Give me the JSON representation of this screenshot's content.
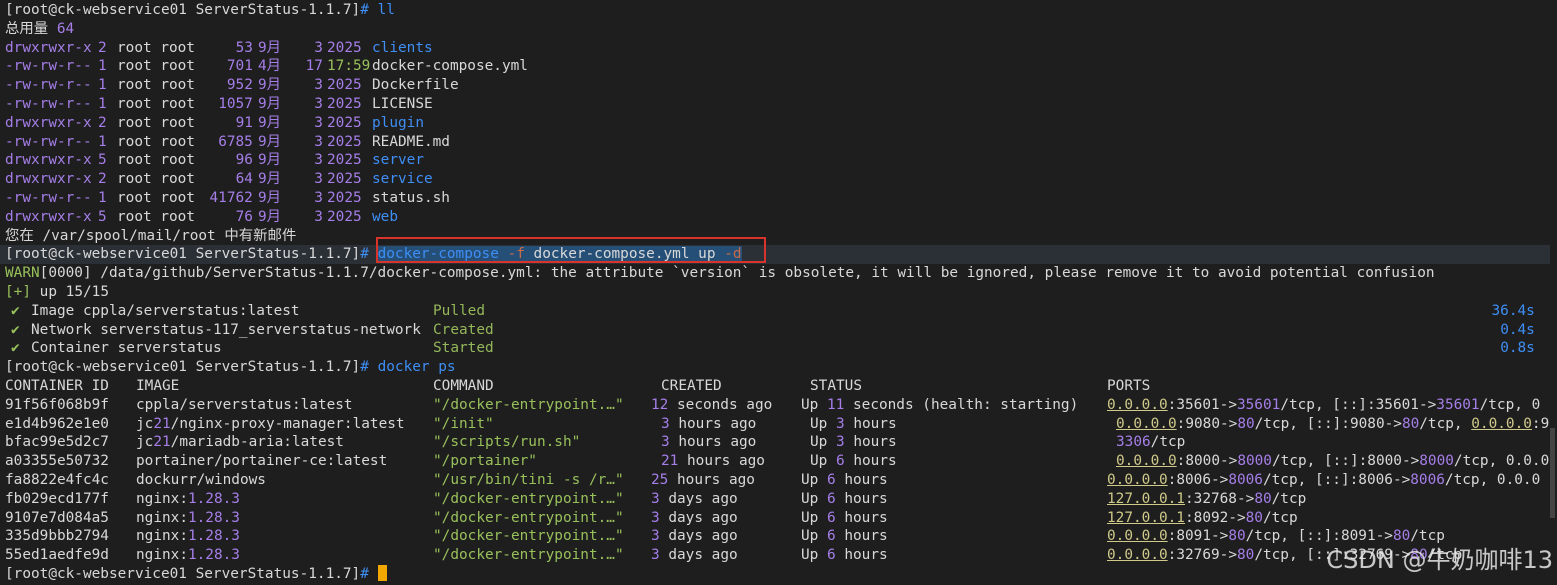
{
  "prompt_user": "[root@ck-webservice01 ServerStatus-1.1.7]",
  "prompt_hash": "#",
  "cmd1": "ll",
  "total": "总用量 64",
  "files": [
    {
      "perm": "drwxrwxr-x",
      "links": "2",
      "owner": "root root",
      "size": "53",
      "month": "9月",
      "day": "3",
      "time": "2025",
      "name": "clients",
      "type": "dir"
    },
    {
      "perm": "-rw-rw-r--",
      "links": "1",
      "owner": "root root",
      "size": "701",
      "month": "4月",
      "day": "17",
      "time": "17:59",
      "name": "docker-compose.yml",
      "type": "file"
    },
    {
      "perm": "-rw-rw-r--",
      "links": "1",
      "owner": "root root",
      "size": "952",
      "month": "9月",
      "day": "3",
      "time": "2025",
      "name": "Dockerfile",
      "type": "file"
    },
    {
      "perm": "-rw-rw-r--",
      "links": "1",
      "owner": "root root",
      "size": "1057",
      "month": "9月",
      "day": "3",
      "time": "2025",
      "name": "LICENSE",
      "type": "file"
    },
    {
      "perm": "drwxrwxr-x",
      "links": "2",
      "owner": "root root",
      "size": "91",
      "month": "9月",
      "day": "3",
      "time": "2025",
      "name": "plugin",
      "type": "dir"
    },
    {
      "perm": "-rw-rw-r--",
      "links": "1",
      "owner": "root root",
      "size": "6785",
      "month": "9月",
      "day": "3",
      "time": "2025",
      "name": "README.md",
      "type": "file"
    },
    {
      "perm": "drwxrwxr-x",
      "links": "5",
      "owner": "root root",
      "size": "96",
      "month": "9月",
      "day": "3",
      "time": "2025",
      "name": "server",
      "type": "dir"
    },
    {
      "perm": "drwxrwxr-x",
      "links": "2",
      "owner": "root root",
      "size": "64",
      "month": "9月",
      "day": "3",
      "time": "2025",
      "name": "service",
      "type": "dir"
    },
    {
      "perm": "-rw-rw-r--",
      "links": "1",
      "owner": "root root",
      "size": "41762",
      "month": "9月",
      "day": "3",
      "time": "2025",
      "name": "status.sh",
      "type": "file"
    },
    {
      "perm": "drwxrwxr-x",
      "links": "5",
      "owner": "root root",
      "size": "76",
      "month": "9月",
      "day": "3",
      "time": "2025",
      "name": "web",
      "type": "dir"
    }
  ],
  "mail": "您在 /var/spool/mail/root 中有新邮件",
  "cmd2": "docker-compose -f docker-compose.yml up -d",
  "warn": "WARN[0000] /data/github/ServerStatus-1.1.7/docker-compose.yml: the attribute `version` is obsolete, it will be ignored, please remove it to avoid potential confusion",
  "up_prefix": "[+]",
  "up_text": "up 15/15",
  "compose_steps": [
    {
      "check": "✔",
      "label": "Image cppla/serverstatus:latest",
      "status": "Pulled",
      "time": "36.4s"
    },
    {
      "check": "✔",
      "label": "Network serverstatus-117_serverstatus-network",
      "status": "Created",
      "time": "0.4s"
    },
    {
      "check": "✔",
      "label": "Container serverstatus",
      "status": "Started",
      "time": "0.8s"
    }
  ],
  "cmd3": "docker ps",
  "ps_headers": [
    "CONTAINER ID",
    "IMAGE",
    "COMMAND",
    "CREATED",
    "STATUS",
    "PORTS"
  ],
  "containers": [
    {
      "id": "91f56f068b9f",
      "image": "cppla/serverstatus:latest",
      "command": "\"/docker-entrypoint.…\"",
      "created": "12 seconds ago",
      "status": "Up 11 seconds (health: starting)",
      "ports": "0.0.0.0:35601->35601/tcp, [::]:35601->35601/tcp, 0"
    },
    {
      "id": "e1d4b962e1e0",
      "image": "jc21/nginx-proxy-manager:latest",
      "command": "\"/init\"",
      "created": "3 hours ago",
      "status": "Up 3 hours",
      "ports": "0.0.0.0:9080->80/tcp, [::]:9080->80/tcp, 0.0.0.0:9"
    },
    {
      "id": "bfac99e5d2c7",
      "image": "jc21/mariadb-aria:latest",
      "command": "\"/scripts/run.sh\"",
      "created": "3 hours ago",
      "status": "Up 3 hours",
      "ports": "3306/tcp"
    },
    {
      "id": "a03355e50732",
      "image": "portainer/portainer-ce:latest",
      "command": "\"/portainer\"",
      "created": "21 hours ago",
      "status": "Up 6 hours",
      "ports": "0.0.0.0:8000->8000/tcp, [::]:8000->8000/tcp, 0.0.0"
    },
    {
      "id": "fa8822e4fc4c",
      "image": "dockurr/windows",
      "command": "\"/usr/bin/tini -s /r…\"",
      "created": "25 hours ago",
      "status": "Up 6 hours",
      "ports": "0.0.0.0:8006->8006/tcp, [::]:8006->8006/tcp, 0.0.0"
    },
    {
      "id": "fb029ecd177f",
      "image": "nginx:1.28.3",
      "command": "\"/docker-entrypoint.…\"",
      "created": "3 days ago",
      "status": "Up 6 hours",
      "ports": "127.0.0.1:32768->80/tcp"
    },
    {
      "id": "9107e7d084a5",
      "image": "nginx:1.28.3",
      "command": "\"/docker-entrypoint.…\"",
      "created": "3 days ago",
      "status": "Up 6 hours",
      "ports": "127.0.0.1:8092->80/tcp"
    },
    {
      "id": "335d9bbb2794",
      "image": "nginx:1.28.3",
      "command": "\"/docker-entrypoint.…\"",
      "created": "3 days ago",
      "status": "Up 6 hours",
      "ports": "0.0.0.0:8091->80/tcp, [::]:8091->80/tcp"
    },
    {
      "id": "55ed1aedfe9d",
      "image": "nginx:1.28.3",
      "command": "\"/docker-entrypoint.…\"",
      "created": "3 days ago",
      "status": "Up 6 hours",
      "ports": "0.0.0.0:32769->80/tcp, [::]:32769->80/tcp"
    }
  ],
  "watermark": "CSDN @牛奶咖啡13",
  "colors": {
    "background": "#1e1e1e",
    "text": "#d8d8d8",
    "directory": "#3e8ef5",
    "permission": "#a57ee8",
    "accent_green": "#98c05b",
    "highlight_box": "#d9342b",
    "cursor": "#f0a800"
  }
}
